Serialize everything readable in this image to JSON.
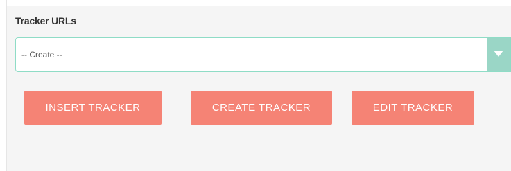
{
  "section": {
    "title": "Tracker URLs"
  },
  "select": {
    "value": "-- Create --"
  },
  "buttons": {
    "insert": "INSERT TRACKER",
    "create": "CREATE TRACKER",
    "edit": "EDIT TRACKER"
  },
  "colors": {
    "button": "#f58375",
    "select_border": "#8fdcc6",
    "select_arrow_bg": "#9ad6c6",
    "panel_bg": "#f5f5f5"
  },
  "icons": {
    "select_arrow": "chevron-down-icon"
  }
}
